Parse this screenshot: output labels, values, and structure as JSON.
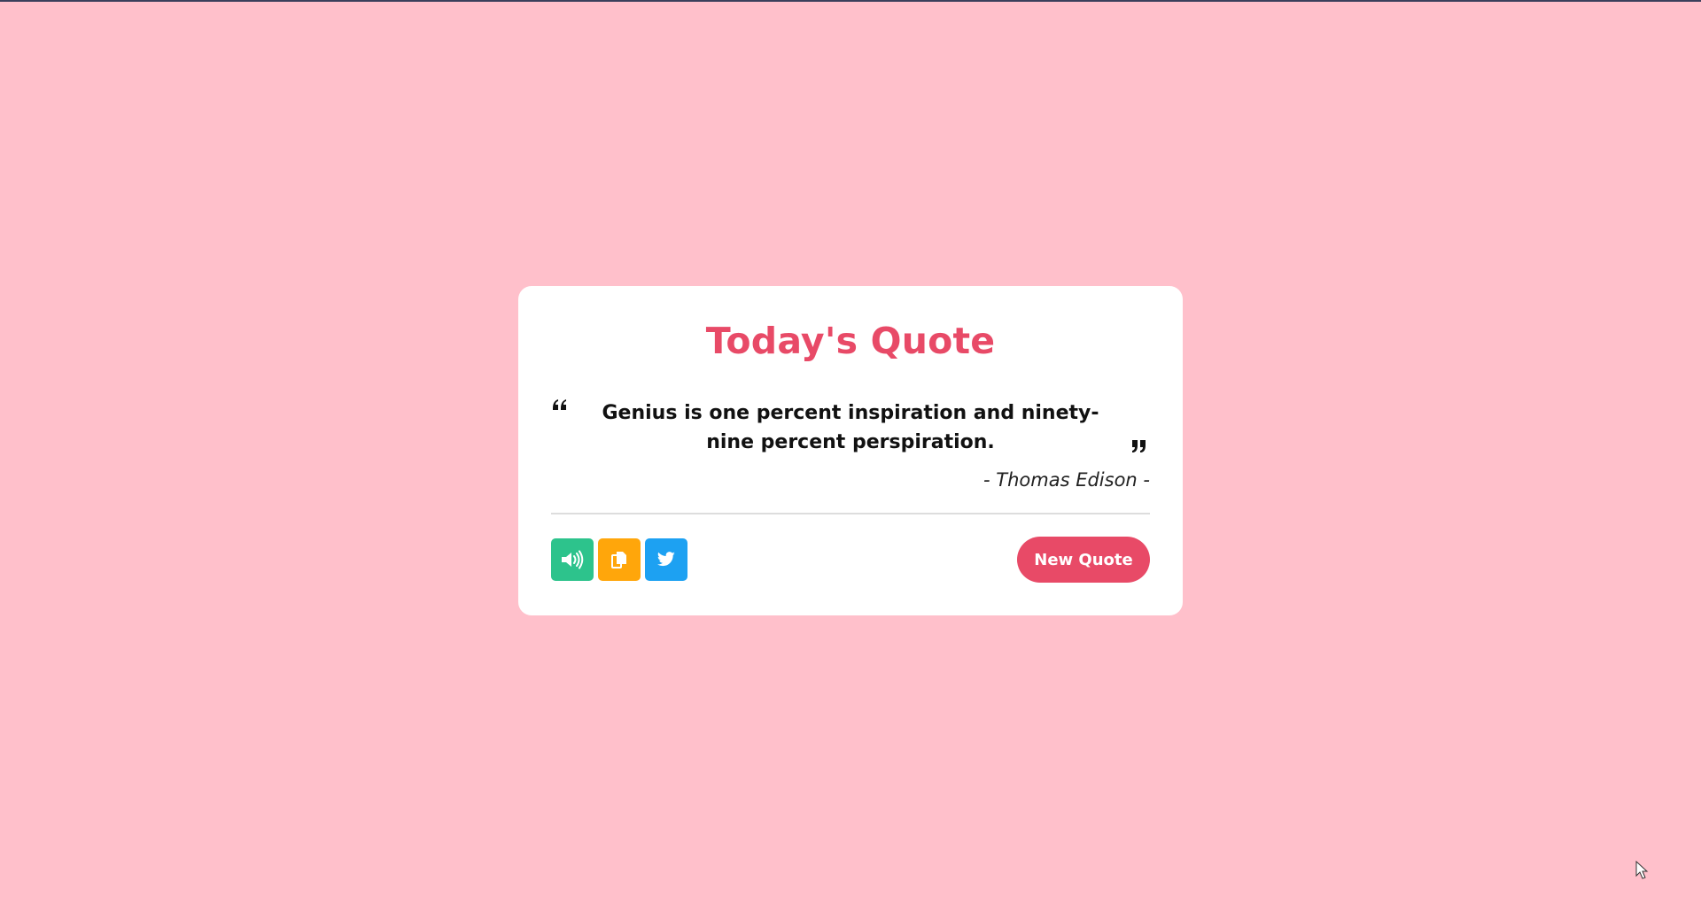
{
  "card": {
    "title": "Today's Quote",
    "quote": "Genius is one percent inspiration and ninety-nine percent perspiration.",
    "author": "- Thomas Edison -",
    "new_quote_label": "New Quote"
  },
  "icons": {
    "speech": "volume-icon",
    "copy": "copy-icon",
    "twitter": "twitter-icon",
    "quote_open": "quote-left-icon",
    "quote_close": "quote-right-icon"
  },
  "colors": {
    "background": "#ffc0cb",
    "accent": "#e84a67",
    "speech": "#2dc38c",
    "copy": "#ffa60b",
    "twitter": "#1da1f2"
  }
}
